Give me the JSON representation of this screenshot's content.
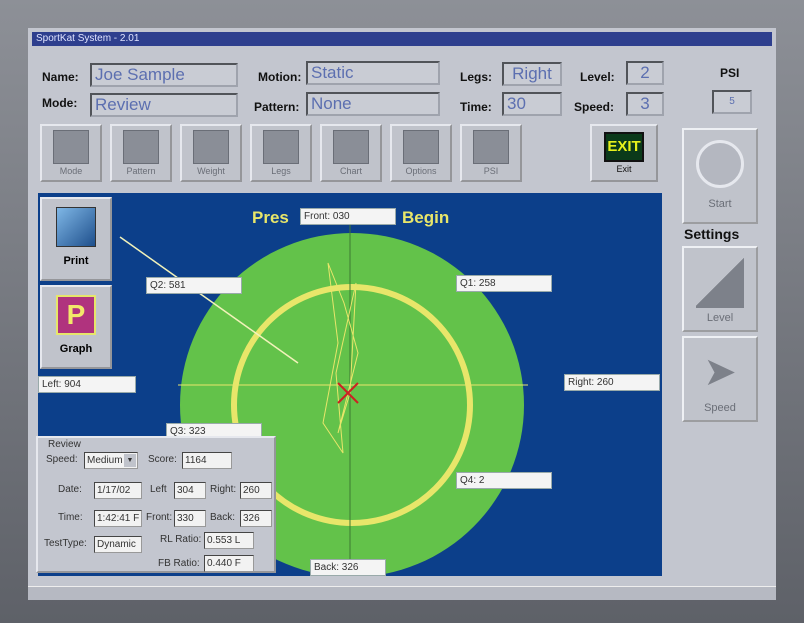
{
  "window": {
    "title": "SportKat System - 2.01"
  },
  "header": {
    "name_label": "Name:",
    "name_value": "Joe Sample",
    "mode_label": "Mode:",
    "mode_value": "Review",
    "motion_label": "Motion:",
    "motion_value": "Static",
    "pattern_label": "Pattern:",
    "pattern_value": "None",
    "legs_label": "Legs:",
    "legs_value": "Right",
    "time_label": "Time:",
    "time_value": "30",
    "level_label": "Level:",
    "level_value": "2",
    "speed_label": "Speed:",
    "speed_value": "3",
    "psi_label": "PSI",
    "psi_value": "5"
  },
  "toolbar": [
    {
      "label": "Mode",
      "icon": "mode-icon"
    },
    {
      "label": "Pattern",
      "icon": "pattern-icon"
    },
    {
      "label": "Weight",
      "icon": "weight-icon"
    },
    {
      "label": "Legs",
      "icon": "legs-icon"
    },
    {
      "label": "Chart",
      "icon": "chart-icon"
    },
    {
      "label": "Options",
      "icon": "options-icon"
    },
    {
      "label": "PSI",
      "icon": "psi-icon"
    }
  ],
  "exit": {
    "sign": "EXIT",
    "label": "Exit"
  },
  "target": {
    "prompt_left": "Pres",
    "prompt_right": "Begin",
    "front": "Front: 030",
    "back": "Back: 326",
    "left": "Left: 904",
    "right": "Right: 260",
    "q1": "Q1: 258",
    "q2": "Q2: 581",
    "q3": "Q3: 323",
    "q4": "Q4: 2"
  },
  "left_tools": {
    "print": "Print",
    "graph": "Graph"
  },
  "right_panel": {
    "start": "Start",
    "settings": "Settings",
    "level": "Level",
    "speed": "Speed"
  },
  "review": {
    "title": "Review",
    "speed_label": "Speed:",
    "speed_value": "Medium",
    "score_label": "Score:",
    "score_value": "1164",
    "date_label": "Date:",
    "date_value": "1/17/02",
    "time_label": "Time:",
    "time_value": "1:42:41 F",
    "testtype_label": "TestType:",
    "testtype_value": "Dynamic",
    "left_label": "Left",
    "left_value": "304",
    "right_label": "Right:",
    "right_value": "260",
    "front_label": "Front:",
    "front_value": "330",
    "back_label": "Back:",
    "back_value": "326",
    "rl_label": "RL Ratio:",
    "rl_value": "0.553 L",
    "fb_label": "FB Ratio:",
    "fb_value": "0.440 F"
  },
  "colors": {
    "field_bg": "#0c3f8a",
    "target_green": "#63c24a",
    "ring_yellow": "#e8e66a"
  }
}
